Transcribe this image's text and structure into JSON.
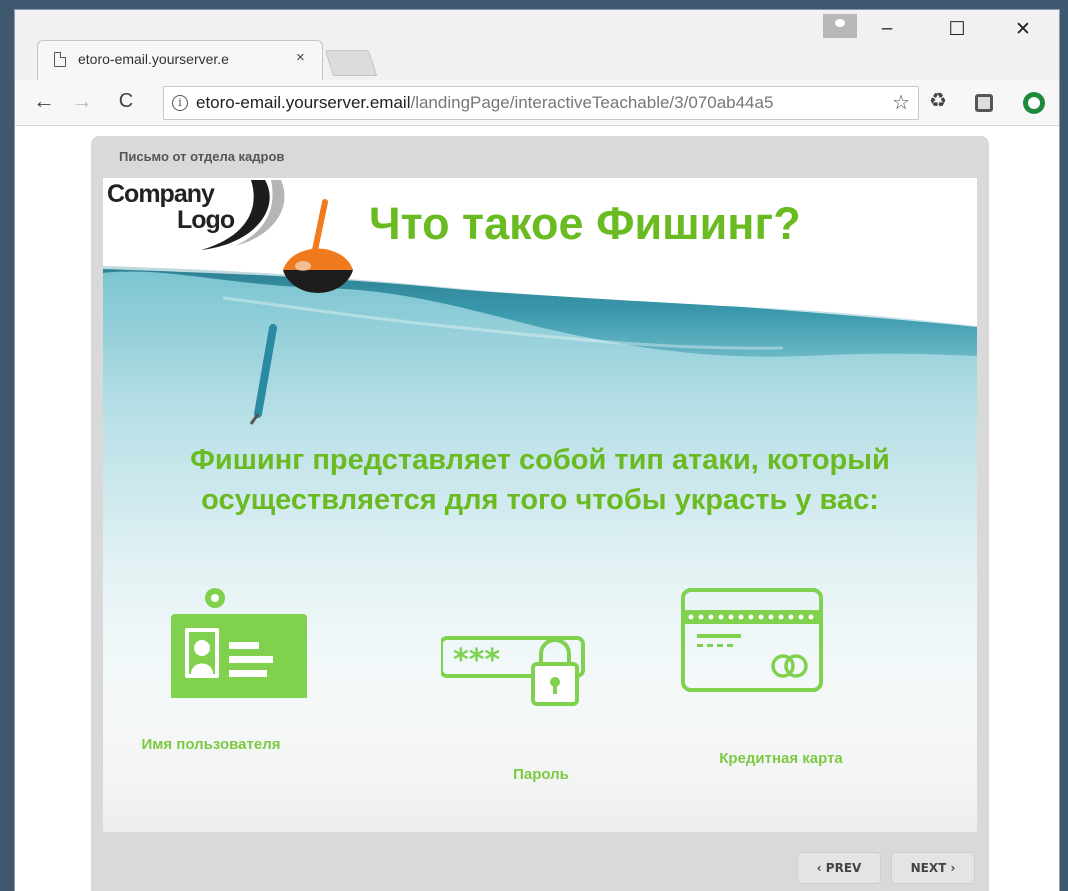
{
  "browser": {
    "tab_title": "etoro-email.yourserver.e",
    "tab_close": "×",
    "url_host": "etoro-email.yourserver.email",
    "url_path": "/landingPage/interactiveTeachable/3/070ab44a5",
    "window_controls": {
      "minimize": "–",
      "maximize": "☐",
      "close": "✕"
    },
    "nav": {
      "back": "←",
      "forward": "→",
      "reload": "C"
    },
    "bookmark_glyph": "☆",
    "info_glyph": "i",
    "recycle_glyph": "♻"
  },
  "player": {
    "title": "Письмо от отдела кадров",
    "prev_label": "‹ PREV",
    "next_label": "NEXT ›"
  },
  "slide": {
    "logo_line1": "Company",
    "logo_line2": "Logo",
    "heading": "Что такое Фишинг?",
    "subtitle": "Фишинг представляет собой тип атаки, который осуществляется для того чтобы украсть у вас:",
    "items": [
      {
        "label": "Имя пользователя",
        "icon": "id-badge-icon"
      },
      {
        "label": "Пароль",
        "icon": "password-lock-icon"
      },
      {
        "label": "Кредитная карта",
        "icon": "credit-card-icon"
      }
    ],
    "password_mask": "***",
    "accent_color": "#6aba22",
    "icon_color": "#7fd14e"
  }
}
